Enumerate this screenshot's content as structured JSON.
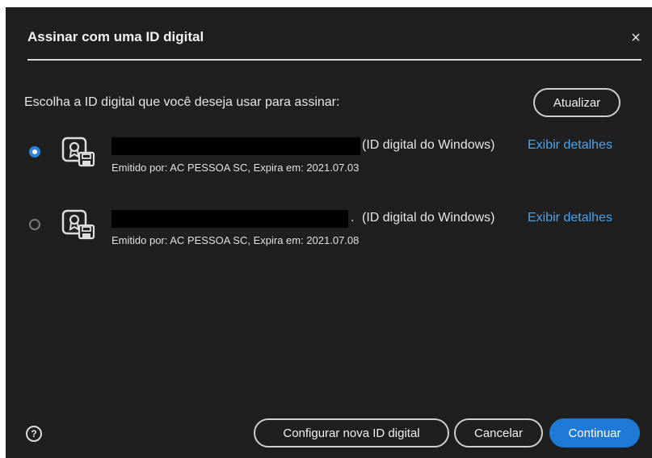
{
  "dialog": {
    "title": "Assinar com uma ID digital",
    "close_glyph": "×",
    "prompt": "Escolha a ID digital que você deseja usar para assinar:",
    "refresh_label": "Atualizar"
  },
  "ids": [
    {
      "selected": true,
      "type_label": "(ID digital do Windows)",
      "details_label": "Exibir detalhes",
      "issuer_line": "Emitido por: AC PESSOA SC, Expira em: 2021.07.03"
    },
    {
      "selected": false,
      "suffix": ".",
      "type_label": "(ID digital do Windows)",
      "details_label": "Exibir detalhes",
      "issuer_line": "Emitido por: AC PESSOA SC, Expira em: 2021.07.08"
    }
  ],
  "footer": {
    "help_glyph": "?",
    "configure_label": "Configurar nova ID digital",
    "cancel_label": "Cancelar",
    "continue_label": "Continuar"
  },
  "colors": {
    "background": "#1f1f1f",
    "accent": "#1f7ad6",
    "link": "#4aa3ec"
  },
  "icons": [
    "close-icon",
    "certificate-icon",
    "help-icon"
  ]
}
